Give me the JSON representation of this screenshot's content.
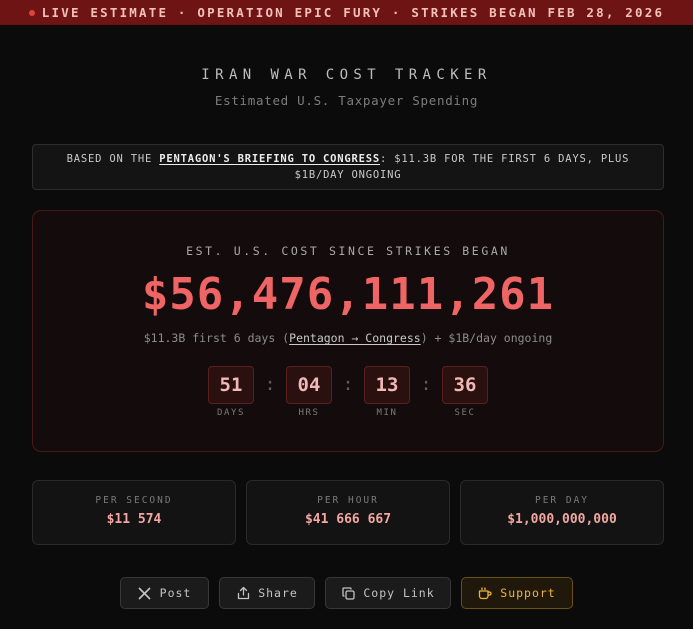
{
  "banner": {
    "text": "LIVE ESTIMATE · OPERATION EPIC FURY · STRIKES BEGAN FEB 28, 2026"
  },
  "header": {
    "title": "IRAN WAR COST TRACKER",
    "subtitle": "Estimated U.S. Taxpayer Spending"
  },
  "source": {
    "prefix": "BASED ON THE ",
    "link": "PENTAGON'S BRIEFING TO CONGRESS",
    "suffix": ": $11.3B FOR THE FIRST 6 DAYS, PLUS $1B/DAY ONGOING"
  },
  "counter": {
    "label": "EST. U.S. COST SINCE STRIKES BEGAN",
    "total": "$56,476,111,261",
    "note_prefix": "$11.3B first 6 days (",
    "note_link": "Pentagon → Congress",
    "note_suffix": ") + $1B/day ongoing"
  },
  "elapsed": {
    "days": "51",
    "hours": "04",
    "minutes": "13",
    "seconds": "36",
    "days_label": "DAYS",
    "hours_label": "HRS",
    "minutes_label": "MIN",
    "seconds_label": "SEC"
  },
  "rates": {
    "per_second_label": "PER SECOND",
    "per_second": "$11 574",
    "per_hour_label": "PER HOUR",
    "per_hour": "$41 666 667",
    "per_day_label": "PER DAY",
    "per_day": "$1,000,000,000"
  },
  "actions": {
    "post": "Post",
    "share": "Share",
    "copy": "Copy Link",
    "support": "Support"
  },
  "icons": {
    "post": "x-logo-icon",
    "share": "share-icon",
    "copy": "copy-icon",
    "support": "coffee-cup-icon"
  },
  "colors": {
    "accent": "#ef6464",
    "banner_bg": "#6f1415",
    "support": "#f0b53a"
  }
}
